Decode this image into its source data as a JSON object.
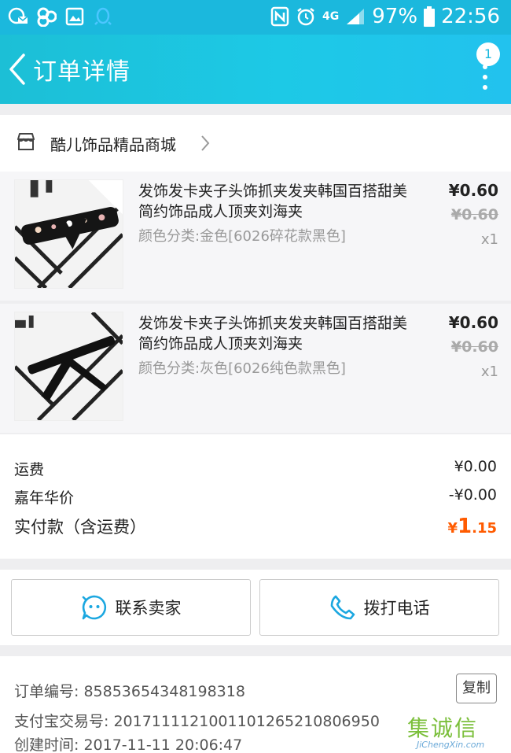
{
  "status_bar": {
    "battery": "97%",
    "time": "22:56",
    "network": "4G"
  },
  "header": {
    "title": "订单详情",
    "badge_count": "1"
  },
  "shop": {
    "name": "酷儿饰品精品商城"
  },
  "products": [
    {
      "title": "发饰发卡夹子头饰抓夹发夹韩国百搭甜美简约饰品成人顶夹刘海夹",
      "sku": "颜色分类:金色[6026碎花款黑色]",
      "price": "¥0.60",
      "original_price": "¥0.60",
      "quantity": "x1"
    },
    {
      "title": "发饰发卡夹子头饰抓夹发夹韩国百搭甜美简约饰品成人顶夹刘海夹",
      "sku": "颜色分类:灰色[6026纯色款黑色]",
      "price": "¥0.60",
      "original_price": "¥0.60",
      "quantity": "x1"
    }
  ],
  "summary": {
    "shipping_label": "运费",
    "shipping_value": "¥0.00",
    "carnival_label": "嘉年华价",
    "carnival_value": "-¥0.00",
    "total_label": "实付款（含运费）",
    "total_currency": "¥",
    "total_integer": "1",
    "total_decimal": ".15"
  },
  "actions": {
    "contact_seller": "联系卖家",
    "call_phone": "拨打电话"
  },
  "order_info": {
    "order_no": "订单编号: 85853654348198318",
    "alipay_no": "支付宝交易号: 2017111121001101265210806950",
    "created": "创建时间: 2017-11-11 20:06:47",
    "copy_label": "复制"
  },
  "watermark": {
    "chars": "集诚信",
    "url": "JiChengXin.com"
  },
  "colors": {
    "header": "#1dc9e6",
    "accent": "#ff5b00",
    "icon_blue": "#1ba7e0"
  }
}
